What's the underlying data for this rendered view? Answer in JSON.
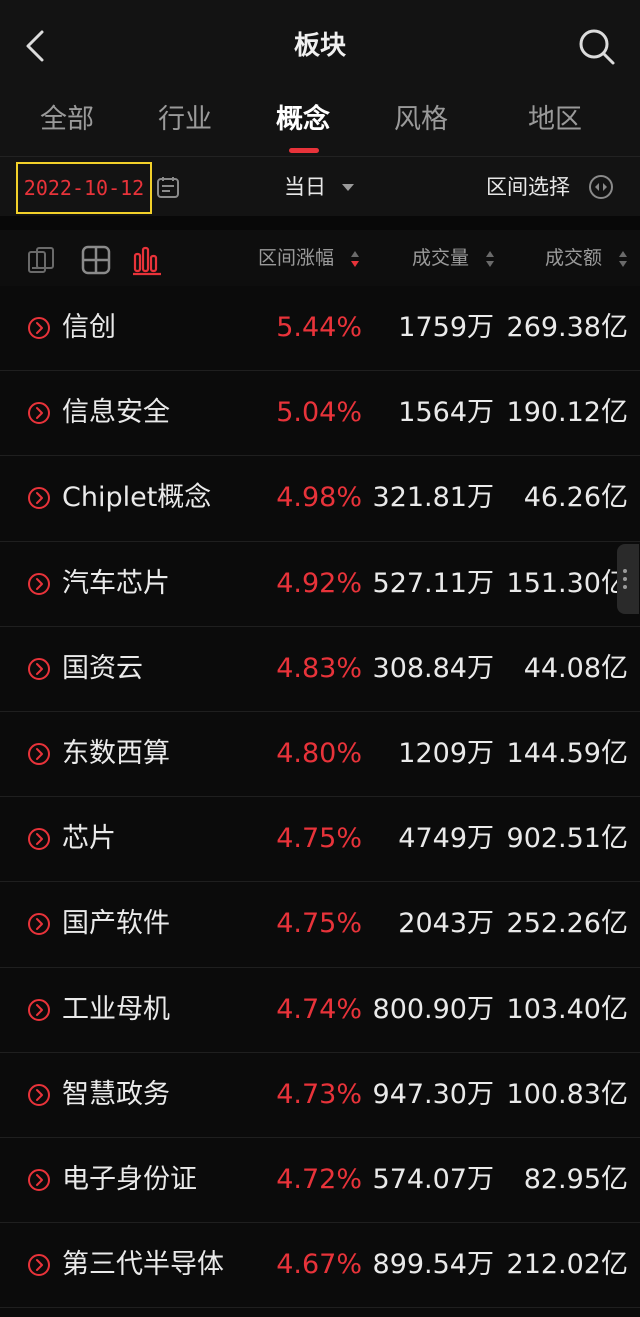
{
  "header": {
    "title": "板块"
  },
  "tabs": [
    {
      "label": "全部"
    },
    {
      "label": "行业"
    },
    {
      "label": "概念"
    },
    {
      "label": "风格"
    },
    {
      "label": "地区"
    }
  ],
  "filter": {
    "date": "2022-10-12",
    "period": "当日",
    "range_select": "区间选择"
  },
  "columns": {
    "change": "区间涨幅",
    "volume": "成交量",
    "amount": "成交额"
  },
  "colors": {
    "accent": "#e8333a",
    "highlight_box": "#f2d02a"
  },
  "rows": [
    {
      "name": "信创",
      "change": "5.44%",
      "volume": "1759万",
      "amount": "269.38亿"
    },
    {
      "name": "信息安全",
      "change": "5.04%",
      "volume": "1564万",
      "amount": "190.12亿"
    },
    {
      "name": "Chiplet概念",
      "change": "4.98%",
      "volume": "321.81万",
      "amount": "46.26亿"
    },
    {
      "name": "汽车芯片",
      "change": "4.92%",
      "volume": "527.11万",
      "amount": "151.30亿"
    },
    {
      "name": "国资云",
      "change": "4.83%",
      "volume": "308.84万",
      "amount": "44.08亿"
    },
    {
      "name": "东数西算",
      "change": "4.80%",
      "volume": "1209万",
      "amount": "144.59亿"
    },
    {
      "name": "芯片",
      "change": "4.75%",
      "volume": "4749万",
      "amount": "902.51亿"
    },
    {
      "name": "国产软件",
      "change": "4.75%",
      "volume": "2043万",
      "amount": "252.26亿"
    },
    {
      "name": "工业母机",
      "change": "4.74%",
      "volume": "800.90万",
      "amount": "103.40亿"
    },
    {
      "name": "智慧政务",
      "change": "4.73%",
      "volume": "947.30万",
      "amount": "100.83亿"
    },
    {
      "name": "电子身份证",
      "change": "4.72%",
      "volume": "574.07万",
      "amount": "82.95亿"
    },
    {
      "name": "第三代半导体",
      "change": "4.67%",
      "volume": "899.54万",
      "amount": "212.02亿"
    }
  ]
}
